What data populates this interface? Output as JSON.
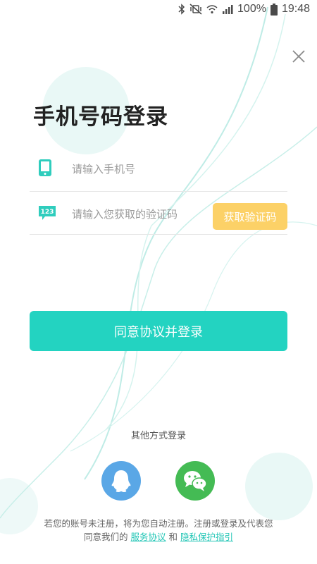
{
  "status_bar": {
    "battery_percent": "100%",
    "time": "19:48",
    "icons": [
      "bluetooth-icon",
      "mute-vibrate-icon",
      "wifi-icon",
      "signal-icon",
      "battery-icon"
    ]
  },
  "header": {
    "close_icon": "close-icon",
    "title": "手机号码登录"
  },
  "form": {
    "phone": {
      "icon": "phone-icon",
      "placeholder": "请输入手机号",
      "value": ""
    },
    "code": {
      "icon": "sms-code-icon",
      "icon_text": "123",
      "placeholder": "请输入您获取的验证码",
      "value": "",
      "button_label": "获取验证码"
    },
    "submit_label": "同意协议并登录"
  },
  "other_login": {
    "label": "其他方式登录",
    "providers": [
      {
        "name": "QQ",
        "icon": "qq-icon"
      },
      {
        "name": "WeChat",
        "icon": "wechat-icon"
      }
    ]
  },
  "terms": {
    "line1": "若您的账号未注册，将为您自动注册。注册或登录及代表您",
    "line2_prefix": "同意我们的",
    "service_link": "服务协议",
    "conjunction": "和",
    "privacy_link": "隐私保护指引"
  },
  "colors": {
    "accent": "#23d3c1",
    "code_button": "#fcd167",
    "qq": "#5aa7e6",
    "wechat": "#44bb54",
    "link": "#23c6b6"
  }
}
